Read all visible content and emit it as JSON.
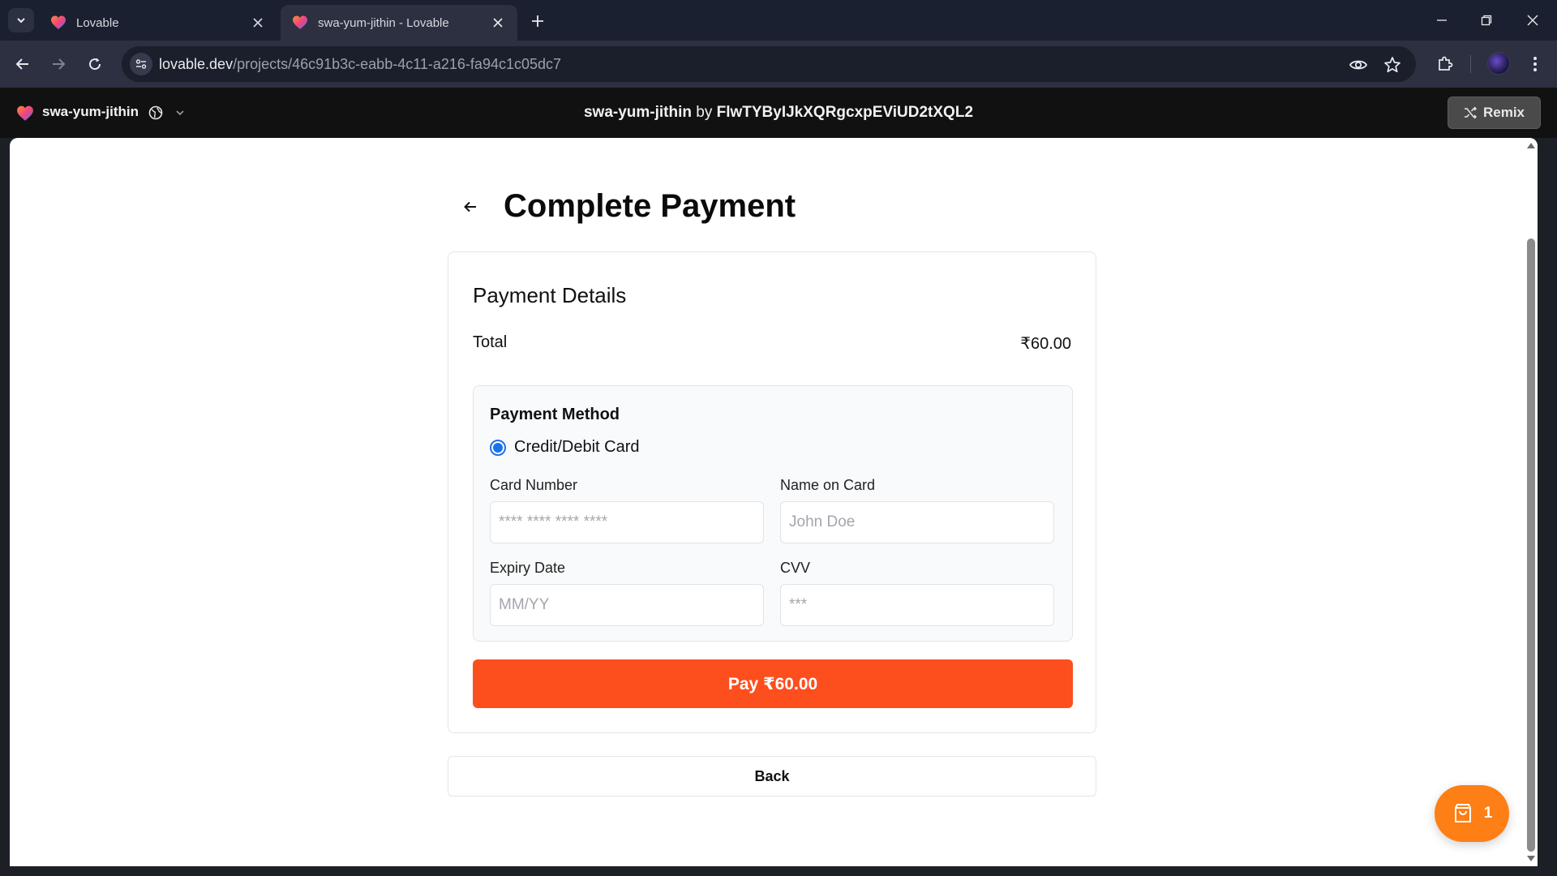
{
  "browser": {
    "tabs": [
      {
        "title": "Lovable",
        "active": false
      },
      {
        "title": "swa-yum-jithin - Lovable",
        "active": true
      }
    ],
    "url_host": "lovable.dev",
    "url_path": "/projects/46c91b3c-eabb-4c11-a216-fa94c1c05dc7"
  },
  "lovable_header": {
    "project_name": "swa-yum-jithin",
    "center_project": "swa-yum-jithin",
    "center_by": " by ",
    "center_author": "FlwTYByIJkXQRgcxpEViUD2tXQL2",
    "remix_label": "Remix"
  },
  "page": {
    "title": "Complete Payment",
    "card_title": "Payment Details",
    "total_label": "Total",
    "total_value": "₹60.00",
    "payment_method": {
      "title": "Payment Method",
      "option_label": "Credit/Debit Card",
      "selected": true
    },
    "fields": {
      "card_number": {
        "label": "Card Number",
        "placeholder": "**** **** **** ****",
        "value": ""
      },
      "name_on_card": {
        "label": "Name on Card",
        "placeholder": "John Doe",
        "value": ""
      },
      "expiry_date": {
        "label": "Expiry Date",
        "placeholder": "MM/YY",
        "value": ""
      },
      "cvv": {
        "label": "CVV",
        "placeholder": "***",
        "value": ""
      }
    },
    "pay_button": "Pay ₹60.00",
    "back_button": "Back",
    "cart_count": "1"
  },
  "colors": {
    "accent_orange": "#fd4e1d",
    "cart_orange": "#fd7f16",
    "radio_blue": "#1a73e8"
  }
}
